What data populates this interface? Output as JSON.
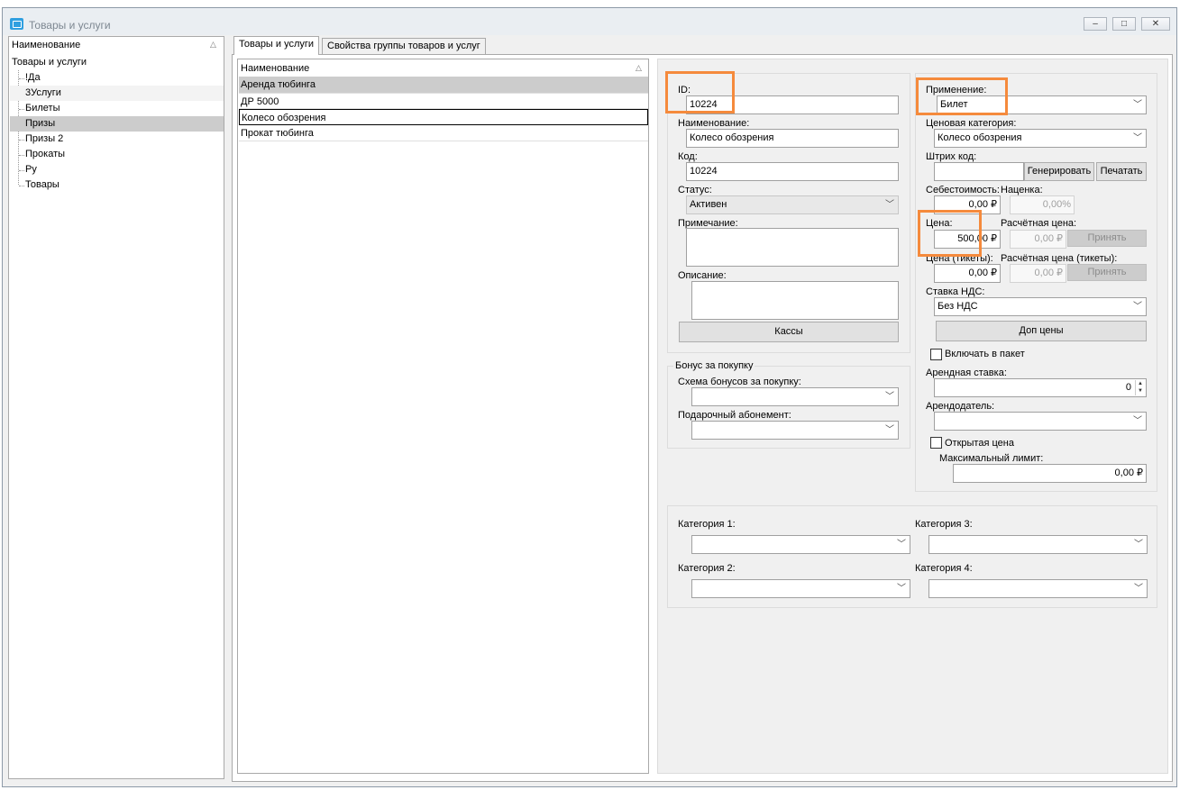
{
  "window": {
    "title": "Товары и услуги",
    "minimize_glyph": "‒",
    "maximize_glyph": "□",
    "close_glyph": "✕"
  },
  "tree": {
    "column_header": "Наименование",
    "root": "Товары и услуги",
    "items": [
      "!Да",
      "3Услуги",
      "Билеты",
      "Призы",
      "Призы 2",
      "Прокаты",
      "Ру",
      "Товары"
    ],
    "selected": "Призы"
  },
  "tabs": [
    {
      "label": "Товары и услуги",
      "active": true
    },
    {
      "label": "Свойства группы товаров и услуг",
      "active": false
    }
  ],
  "list": {
    "column_header": "Наименование",
    "rows": [
      "Аренда тюбинга",
      "ДР 5000",
      "Колесо обозрения",
      "Прокат тюбинга"
    ],
    "selected": "Колесо обозрения"
  },
  "form": {
    "id": {
      "label": "ID:",
      "value": "10224"
    },
    "name": {
      "label": "Наименование:",
      "value": "Колесо обозрения"
    },
    "code": {
      "label": "Код:",
      "value": "10224"
    },
    "status": {
      "label": "Статус:",
      "value": "Активен"
    },
    "note": {
      "label": "Примечание:",
      "value": ""
    },
    "description": {
      "label": "Описание:",
      "value": ""
    },
    "kassy_button": "Кассы",
    "bonus": {
      "group_title": "Бонус за покупку",
      "scheme_label": "Схема бонусов за покупку:",
      "scheme_value": "",
      "gift_label": "Подарочный абонемент:",
      "gift_value": ""
    },
    "application": {
      "label": "Применение:",
      "value": "Билет"
    },
    "price_category": {
      "label": "Ценовая категория:",
      "value": "Колесо обозрения"
    },
    "barcode": {
      "label": "Штрих код:",
      "value": "",
      "generate_button": "Генерировать",
      "print_button": "Печатать"
    },
    "cost": {
      "label": "Себестоимость:",
      "value": "0,00 ₽"
    },
    "markup": {
      "label": "Наценка:",
      "value": "0,00%"
    },
    "price": {
      "label": "Цена:",
      "value": "500,00 ₽"
    },
    "calc_price": {
      "label": "Расчётная цена:",
      "value": "0,00 ₽",
      "apply_button": "Принять"
    },
    "price_tickets": {
      "label": "Цена (тикеты):",
      "value": "0,00 ₽"
    },
    "calc_price_tickets": {
      "label": "Расчётная цена (тикеты):",
      "value": "0,00 ₽",
      "apply_button": "Принять"
    },
    "vat": {
      "label": "Ставка НДС:",
      "value": "Без НДС"
    },
    "extra_prices_button": "Доп цены",
    "include_in_package": {
      "label": "Включать в пакет",
      "checked": false
    },
    "rent_rate": {
      "label": "Арендная ставка:",
      "value": "0"
    },
    "landlord": {
      "label": "Арендодатель:",
      "value": ""
    },
    "open_price": {
      "label": "Открытая цена",
      "checked": false
    },
    "max_limit": {
      "label": "Максимальный лимит:",
      "value": "0,00 ₽"
    },
    "categories": [
      {
        "label": "Категория 1:",
        "value": ""
      },
      {
        "label": "Категория 2:",
        "value": ""
      },
      {
        "label": "Категория 3:",
        "value": ""
      },
      {
        "label": "Категория 4:",
        "value": ""
      }
    ]
  },
  "colors": {
    "highlight": "#f58a3c",
    "selection": "#cccccc",
    "window_bg": "#f0f0f0"
  }
}
